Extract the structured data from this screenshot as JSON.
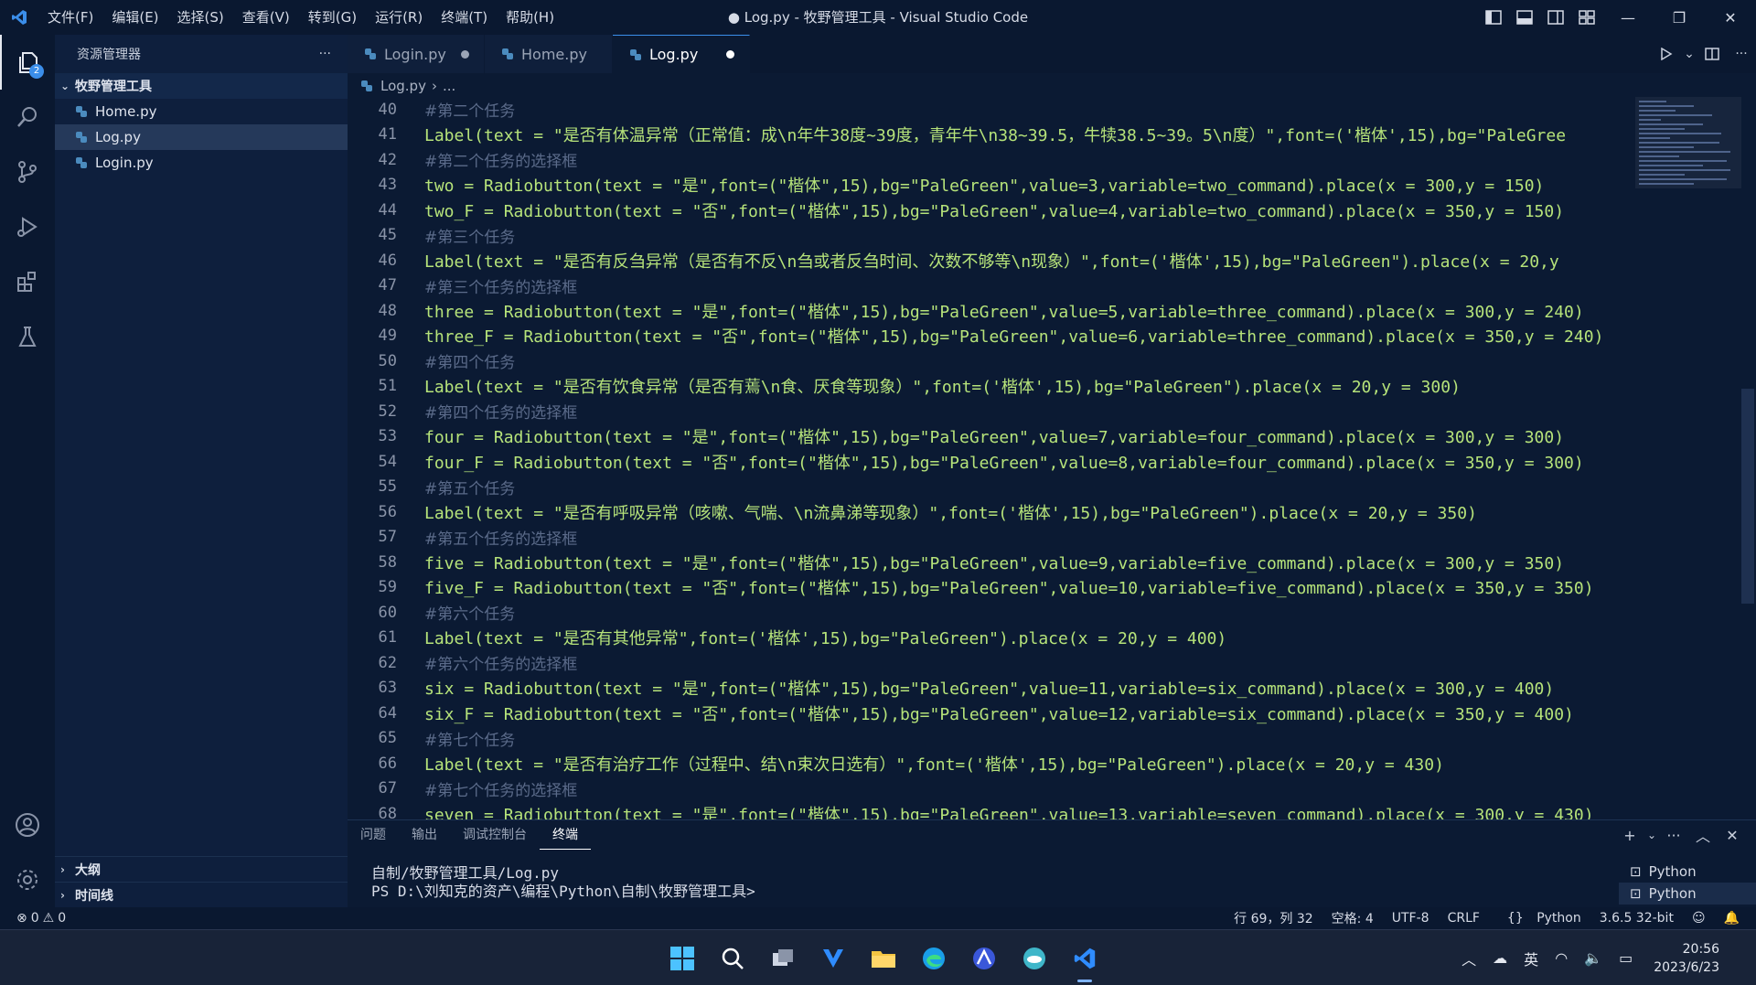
{
  "titlebar": {
    "menu": [
      "文件(F)",
      "编辑(E)",
      "选择(S)",
      "查看(V)",
      "转到(G)",
      "运行(R)",
      "终端(T)",
      "帮助(H)"
    ],
    "title": "● Log.py - 牧野管理工具 - Visual Studio Code",
    "window_controls": [
      "—",
      "❐",
      "✕"
    ]
  },
  "activitybar": {
    "explorer_badge": "2"
  },
  "sidebar": {
    "header": "资源管理器",
    "more": "···",
    "folder": "牧野管理工具",
    "files": [
      "Home.py",
      "Log.py",
      "Login.py"
    ],
    "outline": "大纲",
    "timeline": "时间线"
  },
  "tabs": [
    {
      "label": "Login.py",
      "dirty": true
    },
    {
      "label": "Home.py",
      "dirty": false
    },
    {
      "label": "Log.py",
      "dirty": true
    }
  ],
  "breadcrumb": {
    "file": "Log.py",
    "rest": "..."
  },
  "editor": {
    "lines": [
      {
        "n": "40",
        "t": "#第二个任务",
        "k": "cmt"
      },
      {
        "n": "41",
        "t": "Label(text = \"是否有体温异常（正常值：成\\n年牛38度~39度，青年牛\\n38~39.5，牛犊38.5~39。5\\n度）\",font=('楷体',15),bg=\"PaleGree",
        "k": "code"
      },
      {
        "n": "42",
        "t": "#第二个任务的选择框",
        "k": "cmt"
      },
      {
        "n": "43",
        "t": "two = Radiobutton(text = \"是\",font=(\"楷体\",15),bg=\"PaleGreen\",value=3,variable=two_command).place(x = 300,y = 150)",
        "k": "code"
      },
      {
        "n": "44",
        "t": "two_F = Radiobutton(text = \"否\",font=(\"楷体\",15),bg=\"PaleGreen\",value=4,variable=two_command).place(x = 350,y = 150)",
        "k": "code"
      },
      {
        "n": "45",
        "t": "#第三个任务",
        "k": "cmt"
      },
      {
        "n": "46",
        "t": "Label(text = \"是否有反刍异常（是否有不反\\n刍或者反刍时间、次数不够等\\n现象）\",font=('楷体',15),bg=\"PaleGreen\").place(x = 20,y",
        "k": "code"
      },
      {
        "n": "47",
        "t": "#第三个任务的选择框",
        "k": "cmt"
      },
      {
        "n": "48",
        "t": "three = Radiobutton(text = \"是\",font=(\"楷体\",15),bg=\"PaleGreen\",value=5,variable=three_command).place(x = 300,y = 240)",
        "k": "code"
      },
      {
        "n": "49",
        "t": "three_F = Radiobutton(text = \"否\",font=(\"楷体\",15),bg=\"PaleGreen\",value=6,variable=three_command).place(x = 350,y = 240)",
        "k": "code"
      },
      {
        "n": "50",
        "t": "#第四个任务",
        "k": "cmt"
      },
      {
        "n": "51",
        "t": "Label(text = \"是否有饮食异常（是否有蔫\\n食、厌食等现象）\",font=('楷体',15),bg=\"PaleGreen\").place(x = 20,y = 300)",
        "k": "code"
      },
      {
        "n": "52",
        "t": "#第四个任务的选择框",
        "k": "cmt"
      },
      {
        "n": "53",
        "t": "four = Radiobutton(text = \"是\",font=(\"楷体\",15),bg=\"PaleGreen\",value=7,variable=four_command).place(x = 300,y = 300)",
        "k": "code"
      },
      {
        "n": "54",
        "t": "four_F = Radiobutton(text = \"否\",font=(\"楷体\",15),bg=\"PaleGreen\",value=8,variable=four_command).place(x = 350,y = 300)",
        "k": "code"
      },
      {
        "n": "55",
        "t": "#第五个任务",
        "k": "cmt"
      },
      {
        "n": "56",
        "t": "Label(text = \"是否有呼吸异常（咳嗽、气喘、\\n流鼻涕等现象）\",font=('楷体',15),bg=\"PaleGreen\").place(x = 20,y = 350)",
        "k": "code"
      },
      {
        "n": "57",
        "t": "#第五个任务的选择框",
        "k": "cmt"
      },
      {
        "n": "58",
        "t": "five = Radiobutton(text = \"是\",font=(\"楷体\",15),bg=\"PaleGreen\",value=9,variable=five_command).place(x = 300,y = 350)",
        "k": "code"
      },
      {
        "n": "59",
        "t": "five_F = Radiobutton(text = \"否\",font=(\"楷体\",15),bg=\"PaleGreen\",value=10,variable=five_command).place(x = 350,y = 350)",
        "k": "code"
      },
      {
        "n": "60",
        "t": "#第六个任务",
        "k": "cmt"
      },
      {
        "n": "61",
        "t": "Label(text = \"是否有其他异常\",font=('楷体',15),bg=\"PaleGreen\").place(x = 20,y = 400)",
        "k": "code"
      },
      {
        "n": "62",
        "t": "#第六个任务的选择框",
        "k": "cmt"
      },
      {
        "n": "63",
        "t": "six = Radiobutton(text = \"是\",font=(\"楷体\",15),bg=\"PaleGreen\",value=11,variable=six_command).place(x = 300,y = 400)",
        "k": "code"
      },
      {
        "n": "64",
        "t": "six_F = Radiobutton(text = \"否\",font=(\"楷体\",15),bg=\"PaleGreen\",value=12,variable=six_command).place(x = 350,y = 400)",
        "k": "code"
      },
      {
        "n": "65",
        "t": "#第七个任务",
        "k": "cmt"
      },
      {
        "n": "66",
        "t": "Label(text = \"是否有治疗工作（过程中、结\\n束次日选有）\",font=('楷体',15),bg=\"PaleGreen\").place(x = 20,y = 430)",
        "k": "code"
      },
      {
        "n": "67",
        "t": "#第七个任务的选择框",
        "k": "cmt"
      },
      {
        "n": "68",
        "t": "seven = Radiobutton(text = \"是\",font=(\"楷体\",15),bg=\"PaleGreen\",value=13,variable=seven_command).place(x = 300,y = 430)",
        "k": "code"
      }
    ]
  },
  "panel": {
    "tabs": [
      "问题",
      "输出",
      "调试控制台",
      "终端"
    ],
    "active_tab": "终端",
    "terminal_lines": [
      "自制/牧野管理工具/Log.py",
      "PS D:\\刘知克的资产\\编程\\Python\\自制\\牧野管理工具>"
    ],
    "terminals": [
      "Python",
      "Python"
    ]
  },
  "statusbar": {
    "errors": "0",
    "warnings": "0",
    "position": "行 69，列 32",
    "spaces": "空格: 4",
    "encoding": "UTF-8",
    "eol": "CRLF",
    "language": "Python",
    "interpreter": "3.6.5 32-bit"
  },
  "taskbar": {
    "ime": "英",
    "time": "20:56",
    "date": "2023/6/23"
  },
  "colors": {
    "accent": "#3b8eea",
    "editor_bg": "#0b1a33",
    "comment": "#5b6b8a"
  }
}
